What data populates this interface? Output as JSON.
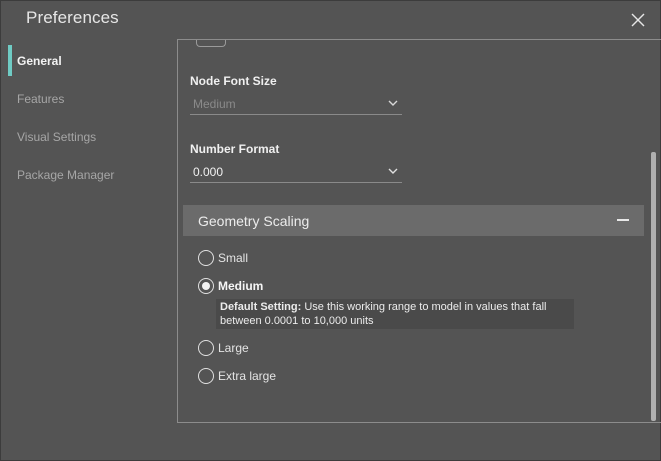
{
  "window": {
    "title": "Preferences"
  },
  "sidebar": {
    "items": [
      {
        "label": "General",
        "active": true
      },
      {
        "label": "Features",
        "active": false
      },
      {
        "label": "Visual Settings",
        "active": false
      },
      {
        "label": "Package Manager",
        "active": false
      }
    ]
  },
  "node_font_size": {
    "label": "Node Font Size",
    "value": "Medium",
    "disabled": true
  },
  "number_format": {
    "label": "Number Format",
    "value": "0.000"
  },
  "geometry_scaling": {
    "title": "Geometry Scaling",
    "options": [
      {
        "label": "Small",
        "selected": false
      },
      {
        "label": "Medium",
        "selected": true
      },
      {
        "label": "Large",
        "selected": false
      },
      {
        "label": "Extra large",
        "selected": false
      }
    ],
    "info": {
      "key": "Default Setting:",
      "text": " Use this working range to model in values that fall",
      "text2": "between 0.0001 to 10,000 units"
    }
  },
  "icons": {
    "close": "close-icon",
    "chevron": "chevron-down-icon",
    "collapse": "minus-icon"
  },
  "colors": {
    "accent": "#6fcbc4",
    "background": "#545454",
    "section_header": "#6b6b6b"
  }
}
